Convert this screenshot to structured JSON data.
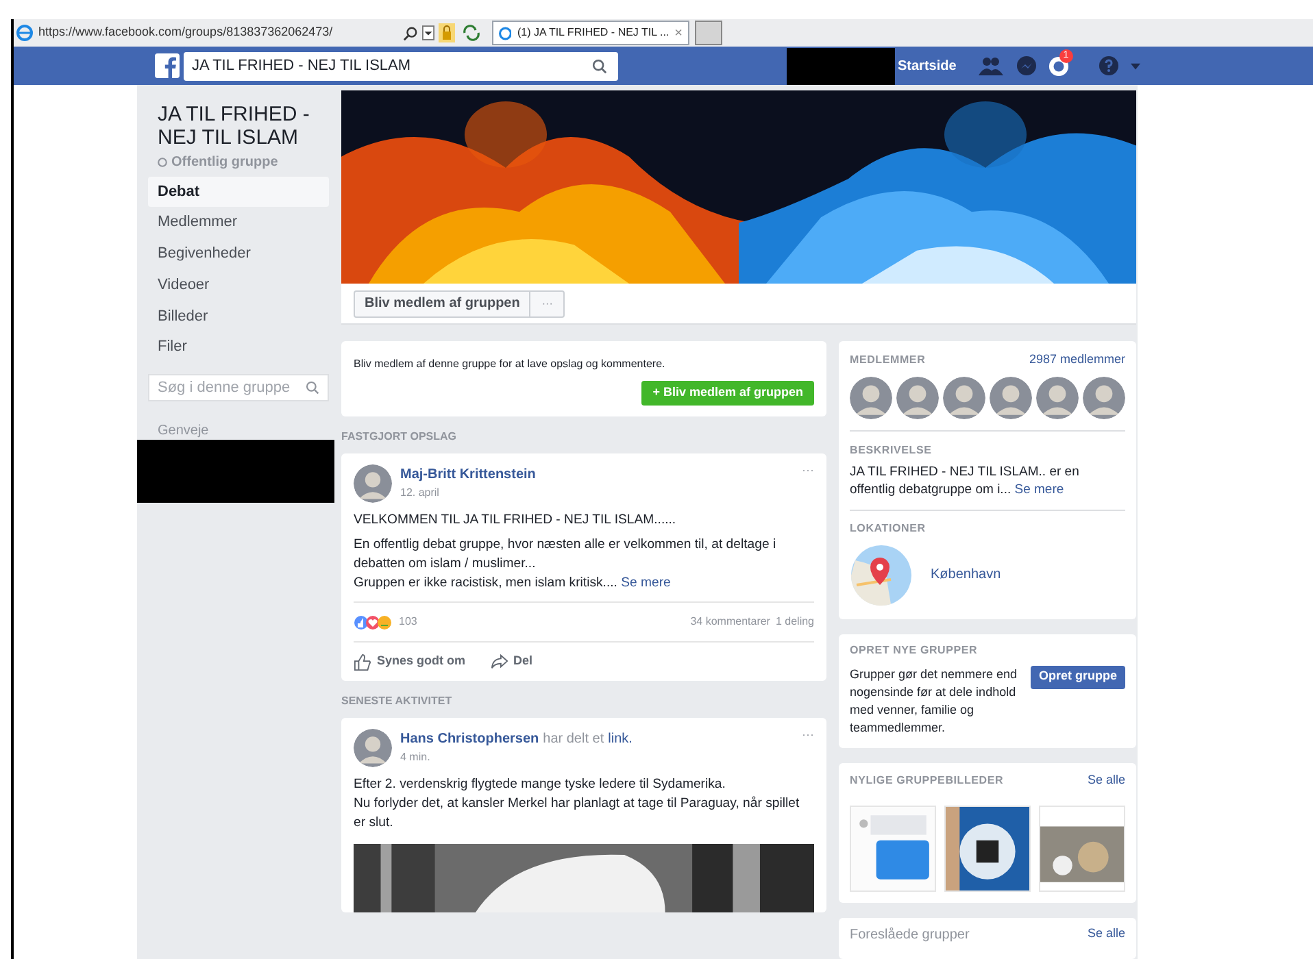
{
  "browser": {
    "url": "https://www.facebook.com/groups/813837362062473/",
    "tab": {
      "title": "(1) JA TIL FRIHED - NEJ TIL ...",
      "close": "×",
      "selected": true
    }
  },
  "topbar": {
    "search_value": "JA TIL FRIHED - NEJ TIL ISLAM",
    "home": "Startside",
    "notifications_badge": "1"
  },
  "sidebar": {
    "group_name": "JA TIL FRIHED - NEJ TIL ISLAM",
    "privacy": "Offentlig gruppe",
    "items": [
      {
        "label": "Debat",
        "selected": true
      },
      {
        "label": "Medlemmer",
        "selected": false
      },
      {
        "label": "Begivenheder",
        "selected": false
      },
      {
        "label": "Videoer",
        "selected": false
      },
      {
        "label": "Billeder",
        "selected": false
      },
      {
        "label": "Filer",
        "selected": false
      }
    ],
    "search": {
      "placeholder": "Søg i denne gruppe"
    },
    "shortcuts": "Genveje"
  },
  "cover": {
    "kind": "picture"
  },
  "actions": {
    "join": "Bliv medlem af gruppen",
    "more": "···"
  },
  "join_card": {
    "text": "Bliv medlem af denne gruppe for at lave opslag og kommentere.",
    "button": "+ Bliv medlem af gruppen"
  },
  "sections": [
    {
      "heading": "FASTGJORT OPSLAG",
      "post": {
        "author": "Maj-Britt Krittenstein",
        "time": "12. april",
        "menu": "···",
        "paragraphs": [
          "VELKOMMEN TIL JA TIL FRIHED - NEJ TIL ISLAM......",
          "En offentlig debat gruppe, hvor næsten alle er velkommen til, at deltage i debatten om islam / muslimer...\nGruppen er ikke racistisk, men islam kritisk...."
        ],
        "see_more": "Se mere",
        "reactions": "103",
        "comments": "34 kommentarer",
        "shares": "1 deling",
        "like": "Synes godt om",
        "share": "Del"
      }
    },
    {
      "heading": "SENESTE AKTIVITET",
      "post": {
        "author": "Hans Christophersen",
        "action": "har delt et",
        "action_link": "link.",
        "time": "4 min.",
        "menu": "···",
        "paragraphs": [
          "Efter 2. verdenskrig flygtede mange tyske ledere til Sydamerika.\nNu forlyder det, at kansler Merkel har planlagt at tage til Paraguay, når spillet er slut."
        ],
        "image": {
          "kind": "picture"
        }
      }
    }
  ],
  "right": {
    "members": {
      "heading": "MEDLEMMER",
      "count": "2987 medlemmer",
      "avatars": [
        {
          "kind": "picture"
        },
        {
          "kind": "picture"
        },
        {
          "kind": "picture"
        },
        {
          "kind": "picture"
        },
        {
          "kind": "picture"
        },
        {
          "kind": "picture"
        }
      ]
    },
    "description": {
      "heading": "BESKRIVELSE",
      "text": "JA TIL FRIHED - NEJ TIL ISLAM.. er en offentlig debatgruppe om i...",
      "see_more": "Se mere"
    },
    "locations": {
      "heading": "LOKATIONER",
      "place": "København"
    },
    "create": {
      "heading": "OPRET NYE GRUPPER",
      "text": "Grupper gør det nemmere end nogensinde før at dele indhold med venner, familie og teammedlemmer.",
      "button": "Opret gruppe"
    },
    "photos": {
      "heading": "NYLIGE GRUPPEBILLEDER",
      "see_all": "Se alle",
      "items": [
        {
          "kind": "picture"
        },
        {
          "kind": "picture"
        },
        {
          "kind": "picture"
        }
      ]
    },
    "suggested": {
      "heading": "Foreslåede grupper",
      "see_all": "Se alle"
    }
  }
}
